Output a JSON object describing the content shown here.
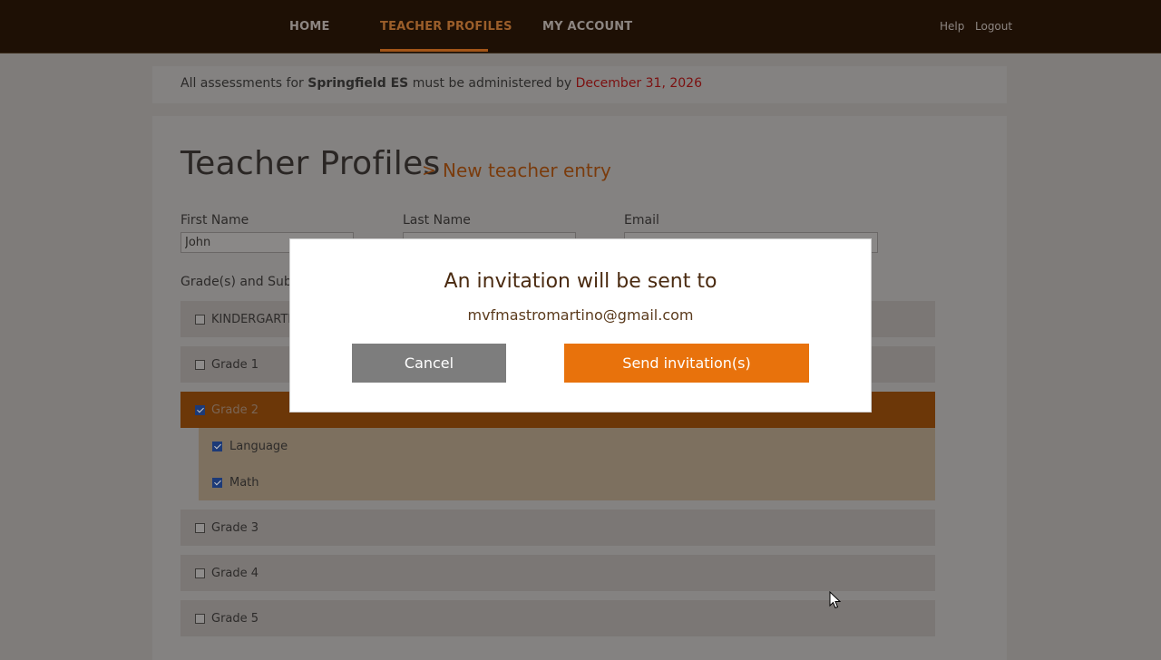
{
  "nav": {
    "items": [
      {
        "label": "HOME"
      },
      {
        "label": "TEACHER PROFILES"
      },
      {
        "label": "MY ACCOUNT"
      }
    ],
    "help": "Help",
    "logout": "Logout"
  },
  "notice": {
    "prefix": "All assessments for",
    "school": "Springfield ES",
    "middle": "must be administered by",
    "deadline": "December 31, 2026"
  },
  "page": {
    "title": "Teacher Profiles",
    "crumb_separator": ">",
    "subtitle": "New teacher entry"
  },
  "form": {
    "first_name_label": "First Name",
    "first_name_value": "John",
    "last_name_label": "Last Name",
    "last_name_value": "",
    "email_label": "Email",
    "email_value": "",
    "grades_label": "Grade(s) and Subjects"
  },
  "grades": [
    {
      "label": "KINDERGARTEN",
      "checked": false
    },
    {
      "label": "Grade 1",
      "checked": false
    },
    {
      "label": "Grade 2",
      "checked": true
    },
    {
      "label": "Grade 3",
      "checked": false
    },
    {
      "label": "Grade 4",
      "checked": false
    },
    {
      "label": "Grade 5",
      "checked": false
    }
  ],
  "subjects": [
    {
      "label": "Language",
      "checked": true
    },
    {
      "label": "Math",
      "checked": true
    }
  ],
  "modal": {
    "title": "An invitation will be sent to",
    "email": "mvfmastromartino@gmail.com",
    "cancel_label": "Cancel",
    "send_label": "Send invitation(s)"
  },
  "colors": {
    "accent": "#e8720c",
    "nav_bg": "#1e1005",
    "deadline": "#c8102e"
  }
}
